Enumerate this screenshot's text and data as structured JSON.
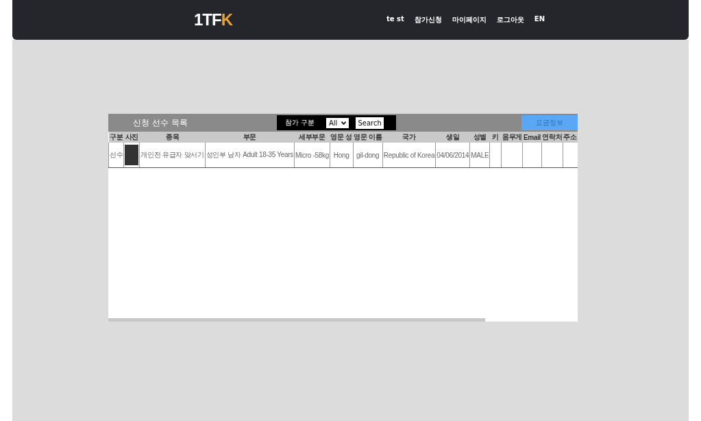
{
  "header": {
    "logo": "1TF",
    "logo_accent": "K",
    "nav": [
      {
        "label": "te st"
      },
      {
        "label": "참가신청"
      },
      {
        "label": "마이페이지"
      },
      {
        "label": "로그아웃"
      },
      {
        "label": "EN"
      }
    ]
  },
  "panel": {
    "title": "신청 선수 목록",
    "filter_label": "참가 구분",
    "filter_value": "All",
    "search_button": "Search",
    "fee_button": "요금정보"
  },
  "table": {
    "columns": [
      "구분",
      "사진",
      "종목",
      "부문",
      "세부부문",
      "영문 성",
      "영문 이름",
      "국가",
      "생일",
      "성별",
      "키",
      "몸무게",
      "Email",
      "연락처",
      "주소"
    ],
    "rows": [
      {
        "cells": [
          "선수",
          "",
          "개인전 유급자 맞서기",
          "성인부 남자 Adult 18-35 Years",
          "Micro -58kg",
          "Hong",
          "gil-dong",
          "Republic of Korea",
          "04/06/2014",
          "MALE",
          "",
          "",
          "",
          "",
          ""
        ]
      }
    ]
  }
}
